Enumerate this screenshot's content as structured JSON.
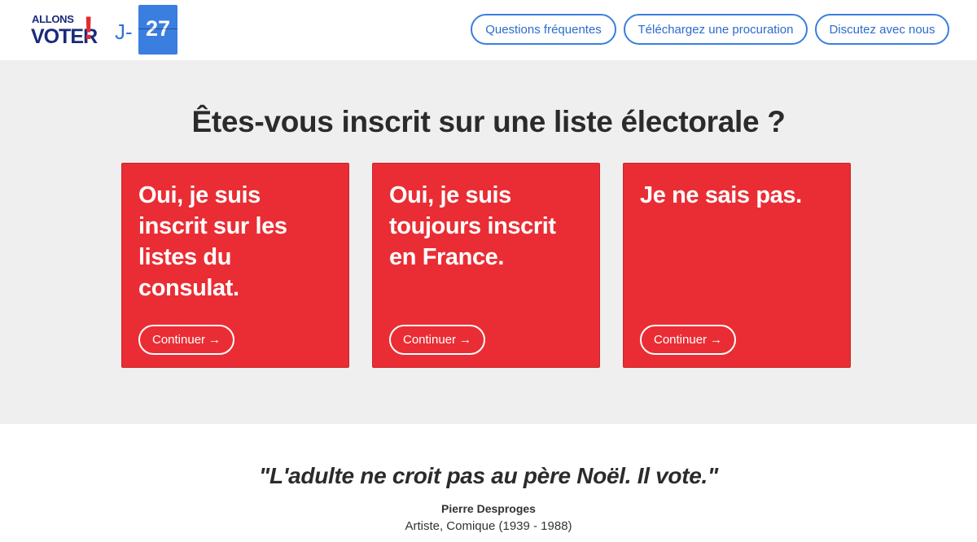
{
  "header": {
    "logo": {
      "line1": "ALLONS",
      "line2": "VOTER",
      "mark": "!"
    },
    "countdown": {
      "prefix": "J-",
      "days": "27"
    },
    "nav": {
      "faq": "Questions fréquentes",
      "proxy": "Téléchargez une procuration",
      "chat": "Discutez avec nous"
    }
  },
  "main": {
    "question": "Êtes-vous inscrit sur une liste électorale ?",
    "options": [
      {
        "text": "Oui, je suis inscrit sur les listes du consulat.",
        "button": "Continuer",
        "arrow": "→"
      },
      {
        "text": "Oui, je suis toujours inscrit en France.",
        "button": "Continuer",
        "arrow": "→"
      },
      {
        "text": "Je ne sais pas.",
        "button": "Continuer",
        "arrow": "→"
      }
    ]
  },
  "quote": {
    "text": "\"L'adulte ne croit pas au père Noël. Il vote.\"",
    "author": "Pierre Desproges",
    "role": "Artiste, Comique (1939 - 1988)"
  },
  "colors": {
    "accent_blue": "#3a7ee0",
    "card_red": "#ea2d34",
    "hero_bg": "#efefef"
  }
}
